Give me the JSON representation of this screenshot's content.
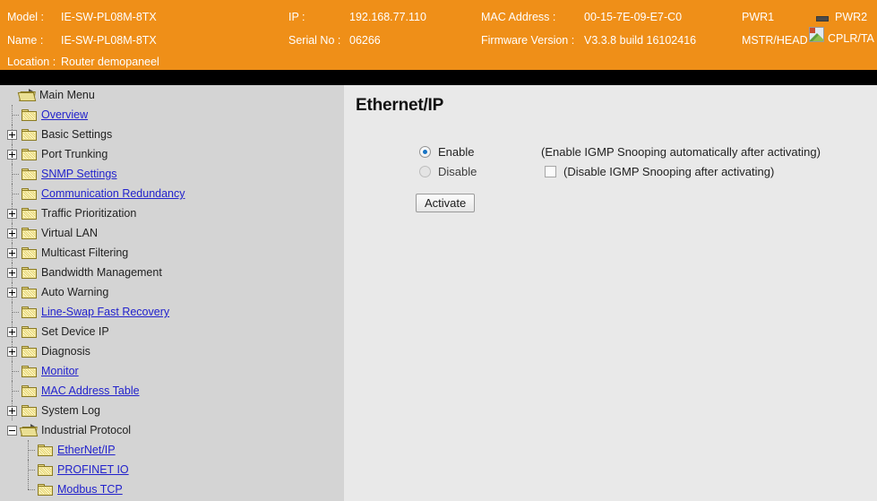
{
  "header": {
    "model_label": "Model :",
    "model_value": "IE-SW-PL08M-8TX",
    "name_label": "Name :",
    "name_value": "IE-SW-PL08M-8TX",
    "location_label": "Location :",
    "location_value": "Router demopaneel",
    "ip_label": "IP :",
    "ip_value": "192.168.77.110",
    "serial_label": "Serial No :",
    "serial_value": "06266",
    "mac_label": "MAC Address :",
    "mac_value": "00-15-7E-09-E7-C0",
    "firmware_label": "Firmware Version :",
    "firmware_value": "V3.3.8 build 16102416",
    "pwr1_label": "PWR1",
    "pwr2_label": "PWR2",
    "mstr_label": "MSTR/HEAD",
    "cplr_label": "CPLR/TA",
    "background_color": "#ef8f18",
    "text_color": "#ffffff",
    "led_color": "#4a4a4a"
  },
  "sidebar": {
    "root_label": "Main Menu",
    "items": [
      {
        "label": "Overview",
        "level": 1,
        "expander": "none",
        "link": true,
        "folder": "closed"
      },
      {
        "label": "Basic Settings",
        "level": 1,
        "expander": "plus",
        "link": false,
        "folder": "closed"
      },
      {
        "label": "Port Trunking",
        "level": 1,
        "expander": "plus",
        "link": false,
        "folder": "closed"
      },
      {
        "label": "SNMP Settings",
        "level": 1,
        "expander": "none",
        "link": true,
        "folder": "closed"
      },
      {
        "label": "Communication Redundancy",
        "level": 1,
        "expander": "none",
        "link": true,
        "folder": "closed"
      },
      {
        "label": "Traffic Prioritization",
        "level": 1,
        "expander": "plus",
        "link": false,
        "folder": "closed"
      },
      {
        "label": "Virtual LAN",
        "level": 1,
        "expander": "plus",
        "link": false,
        "folder": "closed"
      },
      {
        "label": "Multicast Filtering",
        "level": 1,
        "expander": "plus",
        "link": false,
        "folder": "closed"
      },
      {
        "label": "Bandwidth Management",
        "level": 1,
        "expander": "plus",
        "link": false,
        "folder": "closed"
      },
      {
        "label": "Auto Warning",
        "level": 1,
        "expander": "plus",
        "link": false,
        "folder": "closed"
      },
      {
        "label": "Line-Swap Fast Recovery",
        "level": 1,
        "expander": "none",
        "link": true,
        "folder": "closed"
      },
      {
        "label": "Set Device IP",
        "level": 1,
        "expander": "plus",
        "link": false,
        "folder": "closed"
      },
      {
        "label": "Diagnosis",
        "level": 1,
        "expander": "plus",
        "link": false,
        "folder": "closed"
      },
      {
        "label": "Monitor",
        "level": 1,
        "expander": "none",
        "link": true,
        "folder": "closed"
      },
      {
        "label": "MAC Address Table",
        "level": 1,
        "expander": "none",
        "link": true,
        "folder": "closed"
      },
      {
        "label": "System Log",
        "level": 1,
        "expander": "plus",
        "link": false,
        "folder": "closed"
      },
      {
        "label": "Industrial Protocol",
        "level": 1,
        "expander": "minus",
        "link": false,
        "folder": "open"
      },
      {
        "label": "EtherNet/IP",
        "level": 2,
        "expander": "none",
        "link": true,
        "folder": "closed"
      },
      {
        "label": "PROFINET IO",
        "level": 2,
        "expander": "none",
        "link": true,
        "folder": "closed"
      },
      {
        "label": "Modbus TCP",
        "level": 2,
        "expander": "none",
        "link": true,
        "folder": "closed"
      }
    ],
    "background_color": "#d4d4d4",
    "link_color": "#2222cc"
  },
  "main": {
    "title": "Ethernet/IP",
    "enable_label": "Enable",
    "disable_label": "Disable",
    "enable_note": "(Enable IGMP Snooping automatically after activating)",
    "disable_note": "(Disable IGMP Snooping after activating)",
    "activate_label": "Activate",
    "selected_option": "Enable",
    "disable_checkbox_checked": false,
    "background_color": "#e9e9e9",
    "accent_color": "#1773c4"
  }
}
